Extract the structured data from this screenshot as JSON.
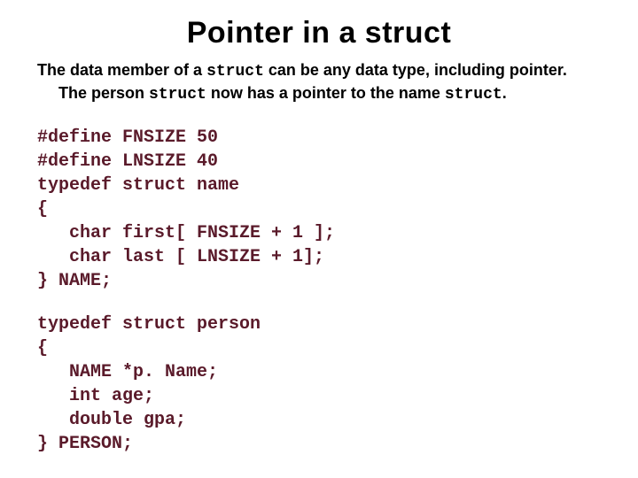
{
  "title": "Pointer in a struct",
  "desc": {
    "line1_a": "The data member of a ",
    "line1_code": "struct",
    "line1_b": " can be any data type, including pointer.",
    "line2_a": "The person ",
    "line2_code1": "struct",
    "line2_b": " now has a pointer to the name ",
    "line2_code2": "struct",
    "line2_c": "."
  },
  "code1": "#define FNSIZE 50\n#define LNSIZE 40\ntypedef struct name\n{\n   char first[ FNSIZE + 1 ];\n   char last [ LNSIZE + 1];\n} NAME;",
  "code2": "typedef struct person\n{\n   NAME *p. Name;\n   int age;\n   double gpa;\n} PERSON;"
}
